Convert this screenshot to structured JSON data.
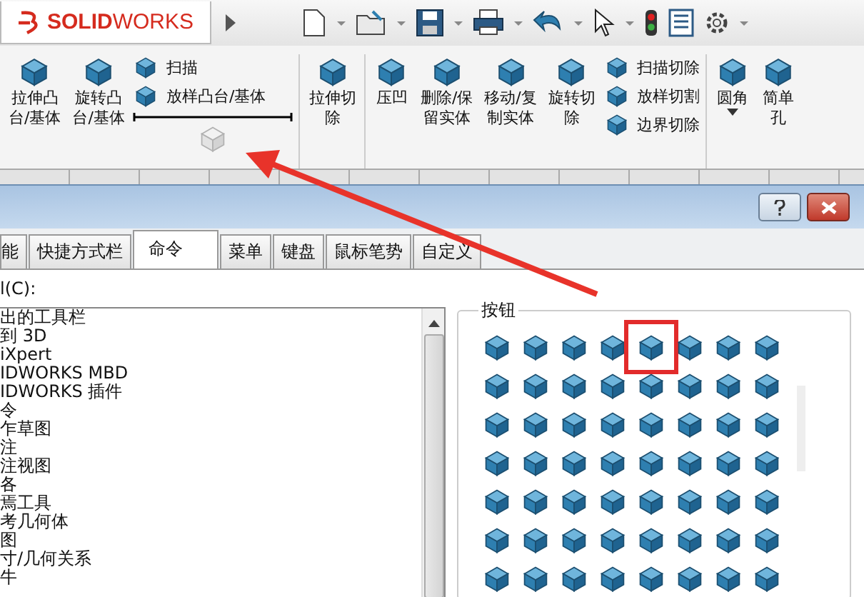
{
  "app": {
    "logo": "**SOLID**WORKS"
  },
  "ribbon": {
    "items": [
      {
        "kind": "large",
        "lines": [
          "拉伸凸",
          "台/基体"
        ]
      },
      {
        "kind": "large",
        "lines": [
          "旋转凸",
          "台/基体"
        ]
      },
      {
        "kind": "stack",
        "entries": [
          "扫描",
          "放样凸台/基体"
        ],
        "drop_target": true
      },
      {
        "kind": "divider"
      },
      {
        "kind": "large",
        "lines": [
          "拉伸切",
          "除"
        ]
      },
      {
        "kind": "divider"
      },
      {
        "kind": "large",
        "lines": [
          "压凹"
        ]
      },
      {
        "kind": "large",
        "lines": [
          "删除/保",
          "留实体"
        ]
      },
      {
        "kind": "large",
        "lines": [
          "移动/复",
          "制实体"
        ]
      },
      {
        "kind": "large",
        "lines": [
          "旋转切",
          "除"
        ]
      },
      {
        "kind": "stack",
        "entries": [
          "扫描切除",
          "放样切割",
          "边界切除"
        ],
        "drop_target": false
      },
      {
        "kind": "divider"
      },
      {
        "kind": "large",
        "lines": [
          "圆角"
        ],
        "dropdown": true
      },
      {
        "kind": "large",
        "lines": [
          "简单",
          "孔"
        ]
      }
    ]
  },
  "dialog": {
    "tabs": [
      {
        "label": "能",
        "selected": false
      },
      {
        "label": "快捷方式栏",
        "selected": false
      },
      {
        "label": "命令",
        "selected": true
      },
      {
        "label": "菜单",
        "selected": false
      },
      {
        "label": "键盘",
        "selected": false
      },
      {
        "label": "鼠标笔势",
        "selected": false
      },
      {
        "label": "自定义",
        "selected": false
      }
    ],
    "category_label": "l(C):",
    "categories": [
      "出的工具栏",
      "到 3D",
      "iXpert",
      "IDWORKS MBD",
      "IDWORKS 插件",
      "令",
      "乍草图",
      "注",
      "注视图",
      "各",
      "焉工具",
      "考几何体",
      "图",
      "寸/几何关系",
      "牛"
    ],
    "buttons_group": {
      "title": "按钮"
    }
  }
}
